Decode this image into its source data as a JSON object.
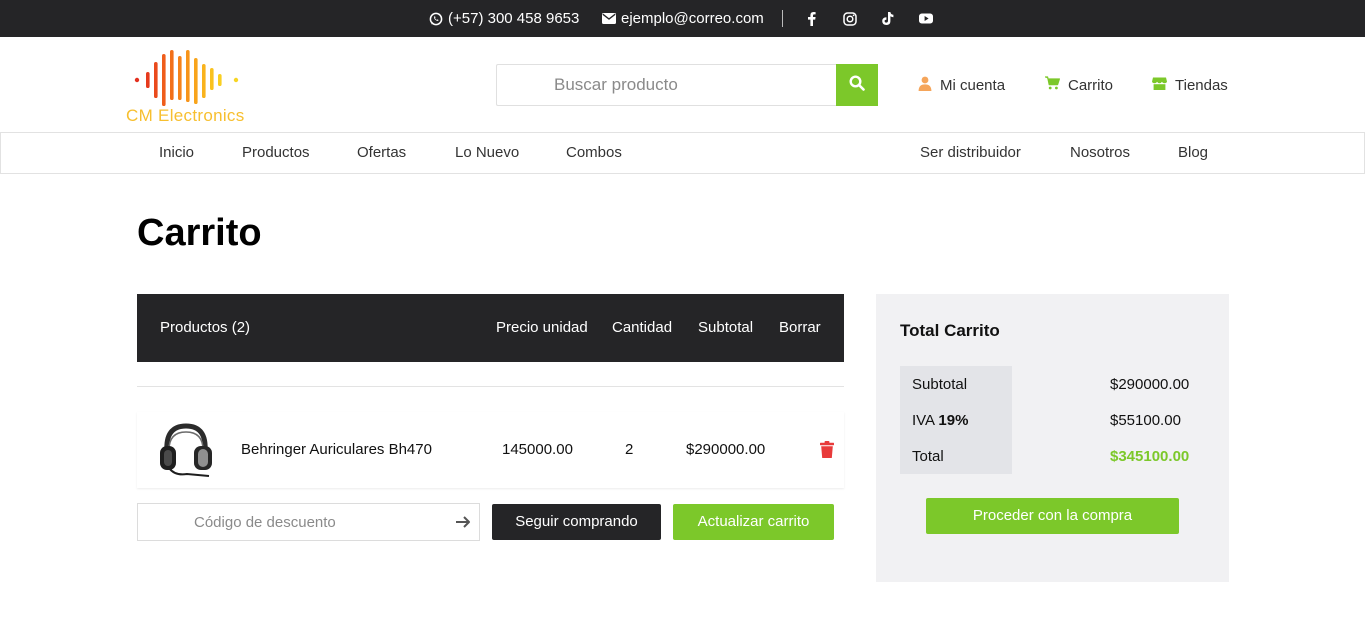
{
  "topbar": {
    "phone": "(+57) 300 458 9653",
    "email": "ejemplo@correo.com",
    "social_icons": [
      "facebook-icon",
      "instagram-icon",
      "tiktok-icon",
      "youtube-icon"
    ]
  },
  "header": {
    "logo_text": "CM Electronics",
    "search_placeholder": "Buscar producto",
    "account_label": "Mi cuenta",
    "cart_label": "Carrito",
    "stores_label": "Tiendas"
  },
  "nav": {
    "left": [
      "Inicio",
      "Productos",
      "Ofertas",
      "Lo Nuevo",
      "Combos"
    ],
    "right": [
      "Ser distribuidor",
      "Nosotros",
      "Blog"
    ]
  },
  "page": {
    "title": "Carrito"
  },
  "cart_table": {
    "headers": {
      "products": "Productos (2)",
      "unit_price": "Precio unidad",
      "quantity": "Cantidad",
      "subtotal": "Subtotal",
      "delete": "Borrar"
    },
    "rows": [
      {
        "name": "Behringer Auriculares Bh470",
        "unit_price": "145000.00",
        "quantity": "2",
        "subtotal": "$290000.00"
      }
    ]
  },
  "actions": {
    "coupon_placeholder": "Código de descuento",
    "continue_label": "Seguir comprando",
    "update_label": "Actualizar carrito"
  },
  "totals": {
    "title": "Total Carrito",
    "subtotal_label": "Subtotal",
    "subtotal_value": "$290000.00",
    "iva_label": "IVA",
    "iva_rate": "19%",
    "iva_value": "$55100.00",
    "total_label": "Total",
    "total_value": "$345100.00",
    "proceed_label": "Proceder con la compra"
  },
  "colors": {
    "accent": "#7cc82a",
    "dark": "#252527",
    "logo_gold": "#f7bf2f",
    "delete_red": "#e83a3a"
  }
}
